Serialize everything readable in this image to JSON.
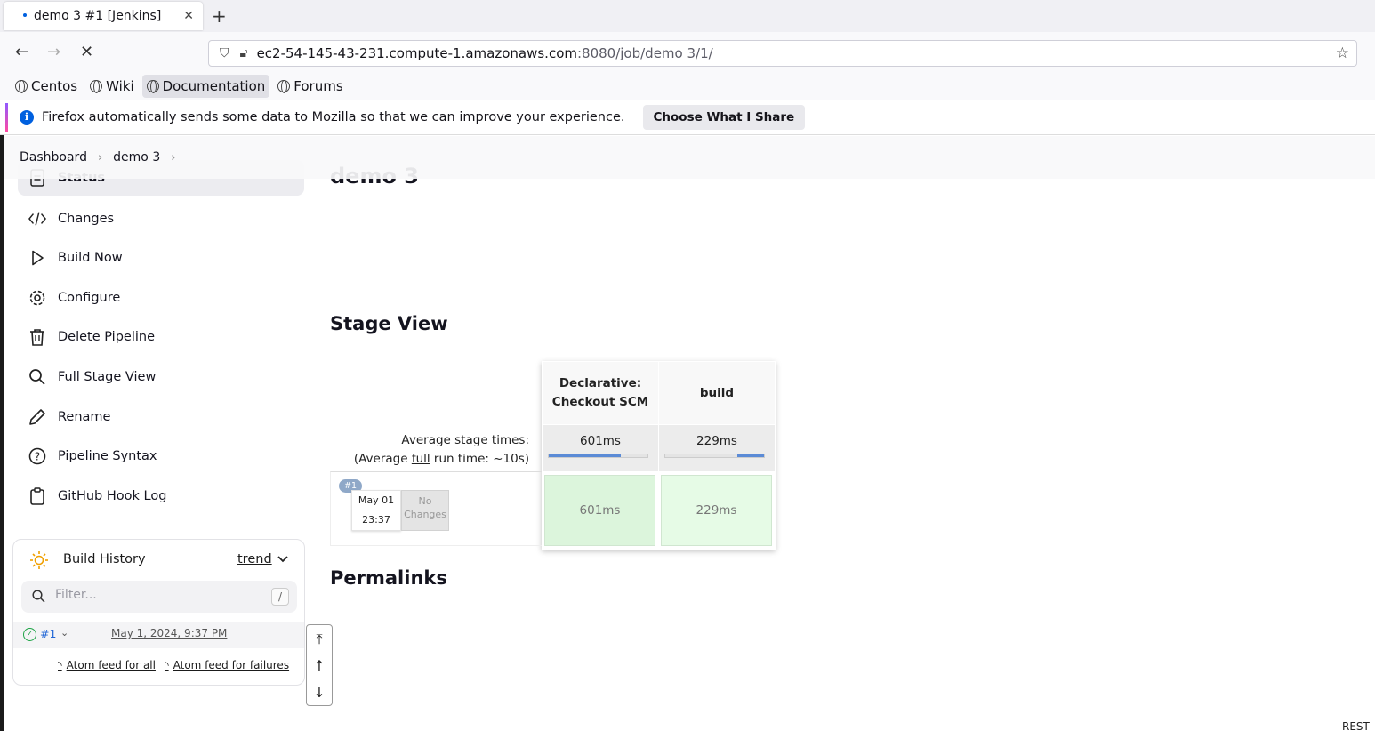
{
  "browser": {
    "tab_title": "demo 3 #1 [Jenkins]",
    "url_host": "ec2-54-145-43-231.compute-1.amazonaws.com",
    "url_rest": ":8080/job/demo 3/1/",
    "bookmarks": [
      "Centos",
      "Wiki",
      "Documentation",
      "Forums"
    ],
    "notice_text": "Firefox automatically sends some data to Mozilla so that we can improve your experience.",
    "notice_button": "Choose What I Share"
  },
  "breadcrumb": [
    "Dashboard",
    "demo 3"
  ],
  "sidebar": {
    "items": [
      {
        "label": "Status",
        "icon": "document-icon"
      },
      {
        "label": "Changes",
        "icon": "code-icon"
      },
      {
        "label": "Build Now",
        "icon": "play-icon"
      },
      {
        "label": "Configure",
        "icon": "gear-icon"
      },
      {
        "label": "Delete Pipeline",
        "icon": "trash-icon"
      },
      {
        "label": "Full Stage View",
        "icon": "search-icon"
      },
      {
        "label": "Rename",
        "icon": "pencil-icon"
      },
      {
        "label": "Pipeline Syntax",
        "icon": "help-icon"
      },
      {
        "label": "GitHub Hook Log",
        "icon": "clipboard-icon"
      }
    ]
  },
  "build_history": {
    "title": "Build History",
    "trend": "trend",
    "filter_placeholder": "Filter...",
    "filter_shortcut": "/",
    "builds": [
      {
        "number": "#1",
        "date": "May 1, 2024, 9:37 PM",
        "status": "success"
      }
    ],
    "feed_all": "Atom feed for all",
    "feed_failures": "Atom feed for failures"
  },
  "main": {
    "title": "demo 3",
    "stage_view_heading": "Stage View",
    "permalinks_heading": "Permalinks",
    "avg_label": "Average stage times:",
    "avg_full_prefix": "(Average ",
    "avg_full_link": "full",
    "avg_full_suffix": " run time: ~10s)",
    "stages": [
      {
        "name": "Declarative: Checkout SCM",
        "avg": "601ms",
        "bar_fraction": 0.73
      },
      {
        "name": "build",
        "avg": "229ms",
        "bar_fraction": 0.27
      }
    ],
    "run": {
      "badge": "#1",
      "date_line1": "May 01",
      "date_line2": "23:37",
      "changes": "No Changes",
      "cells": [
        "601ms",
        "229ms"
      ]
    },
    "rest_text": "REST A"
  },
  "colors": {
    "success_cell": "#e0f8e0",
    "bar_fill": "#5b8bd6",
    "ok_green": "#1ea446"
  }
}
